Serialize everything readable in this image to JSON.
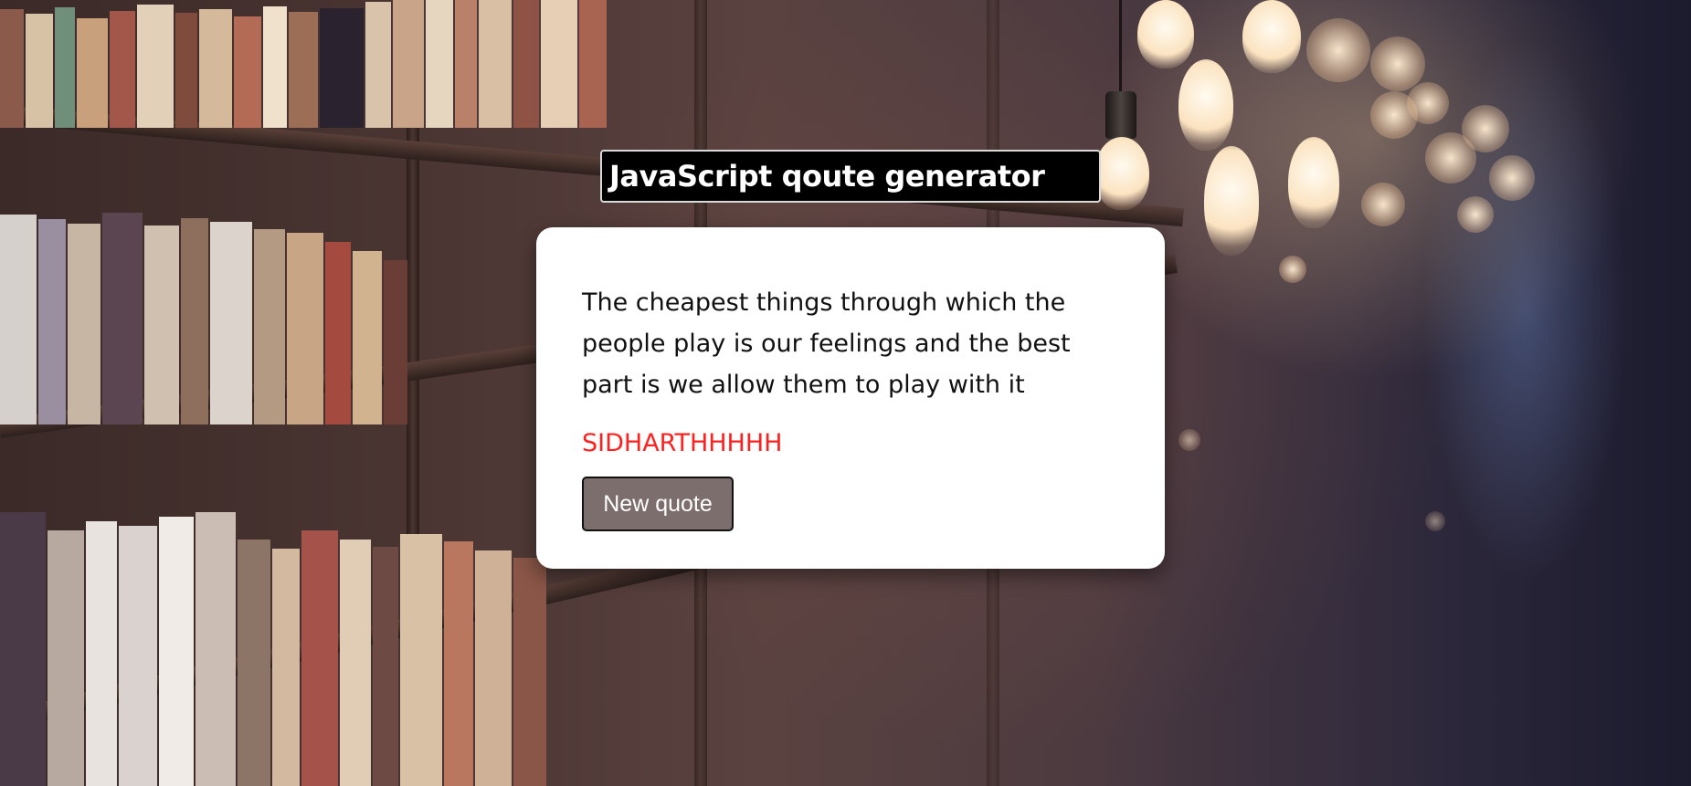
{
  "page": {
    "heading": "JavaScript qoute generator"
  },
  "quote": {
    "text": "The cheapest things through which the people play is our feelings and the best part is we allow them to play with it",
    "author": "SIDHARTHHHHH"
  },
  "controls": {
    "new_quote_label": "New quote"
  },
  "colors": {
    "heading_background": "#000000",
    "heading_text": "#ffffff",
    "card_background": "#ffffff",
    "author_text": "#ff2020",
    "button_background": "#7d6e6e"
  },
  "background": {
    "description_icon": "library-bookshelf-background"
  }
}
